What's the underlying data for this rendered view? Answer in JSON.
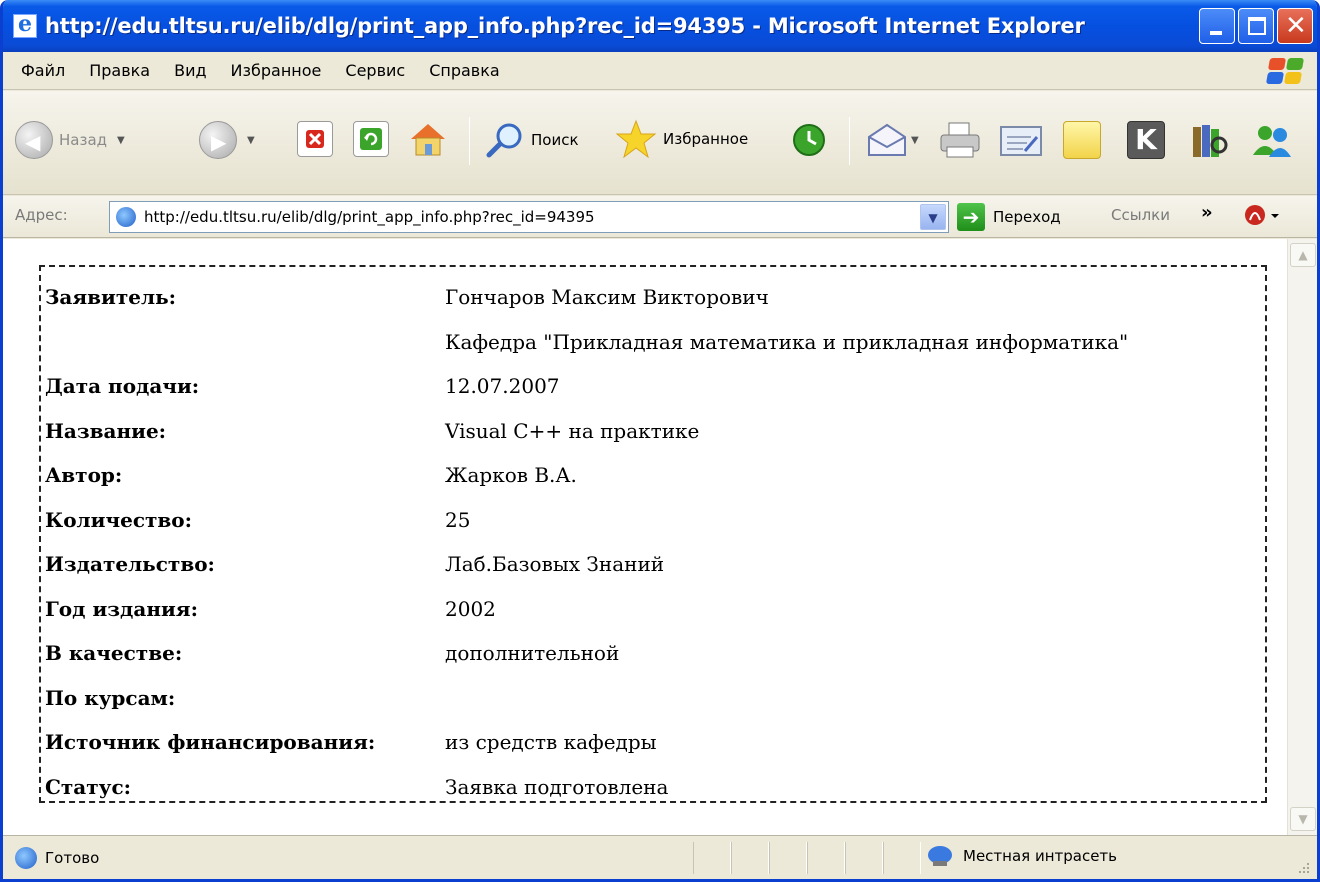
{
  "window": {
    "title": "http://edu.tltsu.ru/elib/dlg/print_app_info.php?rec_id=94395 - Microsoft Internet Explorer"
  },
  "menu": {
    "items": [
      {
        "label": "Файл"
      },
      {
        "label": "Правка"
      },
      {
        "label": "Вид"
      },
      {
        "label": "Избранное"
      },
      {
        "label": "Сервис"
      },
      {
        "label": "Справка"
      }
    ]
  },
  "toolbar": {
    "back_label": "Назад",
    "search_label": "Поиск",
    "favorites_label": "Избранное",
    "icons": [
      "back-icon",
      "forward-icon",
      "stop-icon",
      "refresh-icon",
      "home-icon",
      "search-icon",
      "favorites-star-icon",
      "history-icon",
      "mail-icon",
      "print-icon",
      "edit-icon",
      "discuss-icon",
      "messenger-icon",
      "research-icon",
      "users-icon"
    ]
  },
  "address": {
    "label": "Адрес:",
    "url": "http://edu.tltsu.ru/elib/dlg/print_app_info.php?rec_id=94395",
    "go_label": "Переход",
    "links_label": "Ссылки"
  },
  "record": {
    "rows": [
      {
        "label": "Заявитель:",
        "value": "Гончаров Максим Викторович"
      },
      {
        "label": "",
        "value": "Кафедра \"Прикладная математика и прикладная информатика\""
      },
      {
        "label": "Дата подачи:",
        "value": "12.07.2007"
      },
      {
        "label": "Название:",
        "value": "Visual C++ на практике"
      },
      {
        "label": "Автор:",
        "value": "Жарков В.А."
      },
      {
        "label": "Количество:",
        "value": "25"
      },
      {
        "label": "Издательство:",
        "value": "Лаб.Базовых Знаний"
      },
      {
        "label": "Год издания:",
        "value": "2002"
      },
      {
        "label": "В качестве:",
        "value": "дополнительной"
      },
      {
        "label": "По курсам:",
        "value": ""
      },
      {
        "label": "Источник финансирования:",
        "value": "из средств кафедры"
      },
      {
        "label": "Статус:",
        "value": "Заявка подготовлена"
      }
    ]
  },
  "status": {
    "text": "Готово",
    "zone": "Местная интрасеть"
  },
  "colors": {
    "titlebar": "#0650e0",
    "chrome": "#ece9d8",
    "close_button": "#c83a1e"
  }
}
